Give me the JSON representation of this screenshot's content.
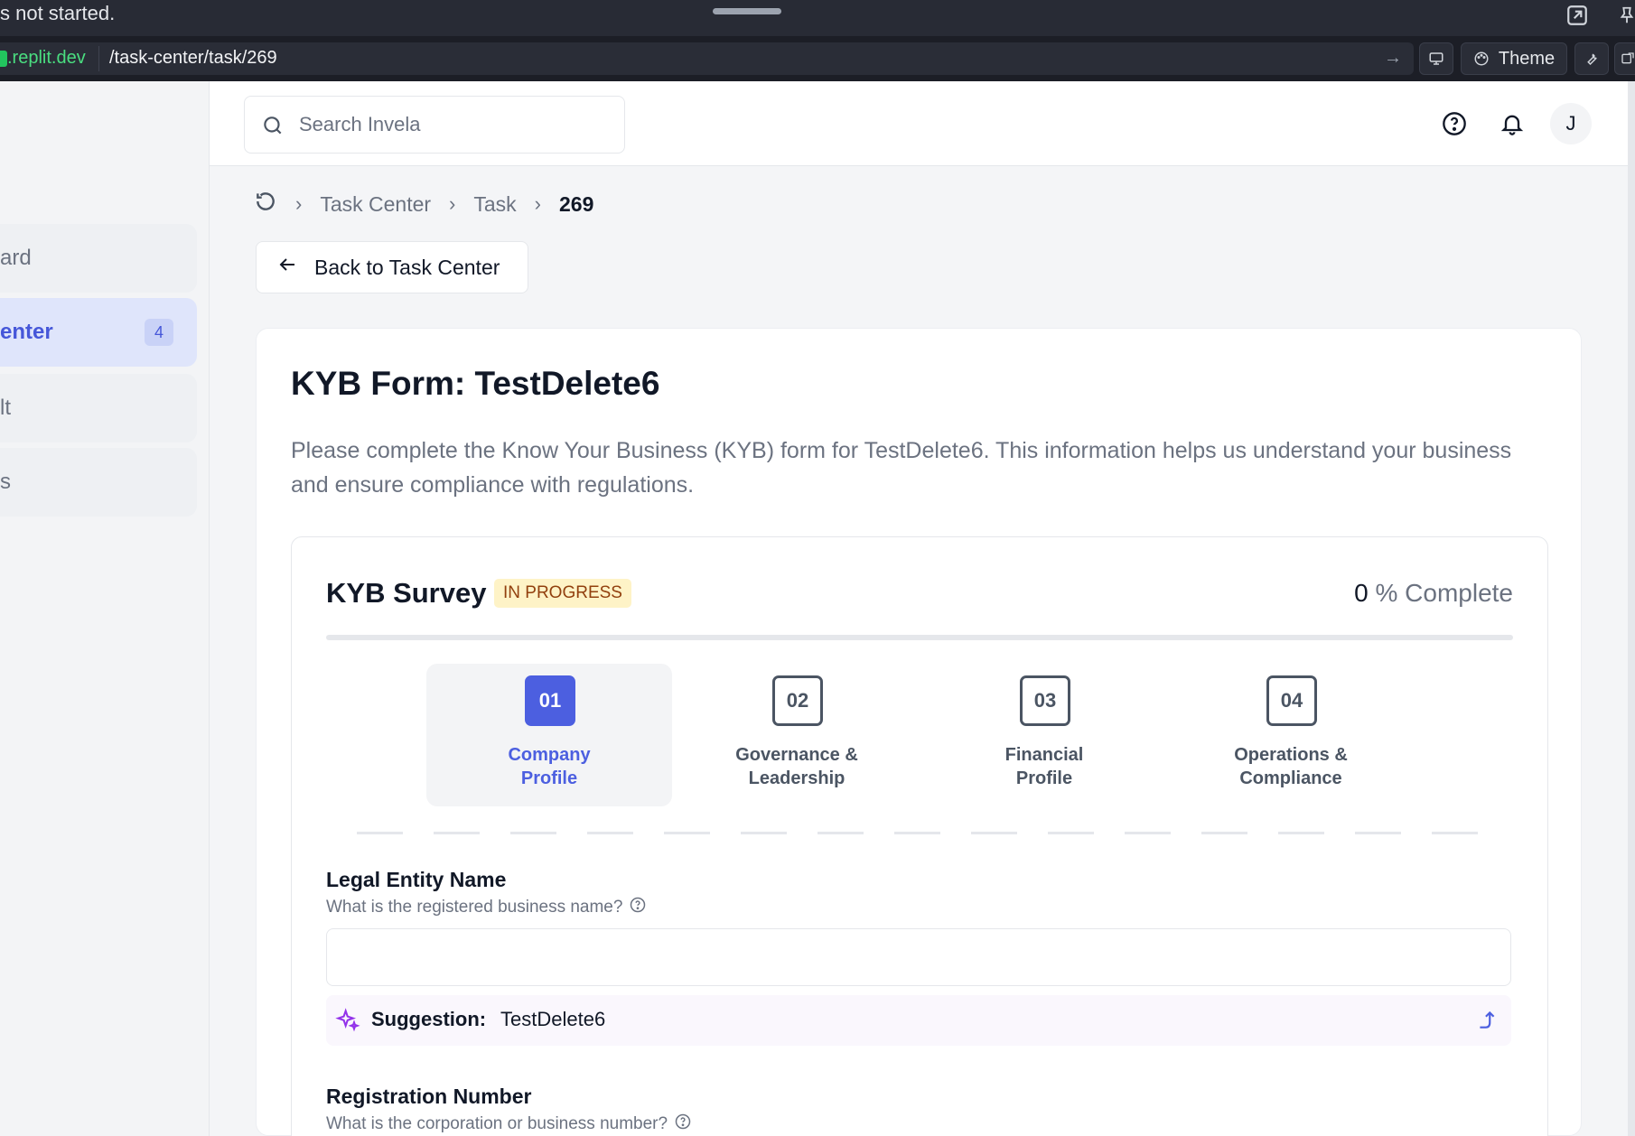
{
  "status_bar": {
    "text": "s not started."
  },
  "url_bar": {
    "domain": ".replit.dev",
    "path": "/task-center/task/269",
    "theme_label": "Theme"
  },
  "sidebar": {
    "items": [
      {
        "label": "ard",
        "active": false
      },
      {
        "label": "enter",
        "active": true,
        "badge": "4"
      },
      {
        "label": "lt",
        "active": false
      },
      {
        "label": "s",
        "active": false
      }
    ]
  },
  "header": {
    "search_placeholder": "Search Invela",
    "avatar_initial": "J"
  },
  "breadcrumb": {
    "items": [
      "Task Center",
      "Task"
    ],
    "current": "269"
  },
  "back_button": {
    "label": "Back to Task Center"
  },
  "form": {
    "title": "KYB Form: TestDelete6",
    "description": "Please complete the Know Your Business (KYB) form for TestDelete6. This information helps us understand your business and ensure compliance with regulations."
  },
  "survey": {
    "title": "KYB Survey",
    "status": "IN PROGRESS",
    "percent": "0",
    "percent_label": "% Complete",
    "progress_fraction": 0,
    "steps": [
      {
        "num": "01",
        "label_line1": "Company",
        "label_line2": "Profile",
        "active": true
      },
      {
        "num": "02",
        "label_line1": "Governance &",
        "label_line2": "Leadership",
        "active": false
      },
      {
        "num": "03",
        "label_line1": "Financial",
        "label_line2": "Profile",
        "active": false
      },
      {
        "num": "04",
        "label_line1": "Operations &",
        "label_line2": "Compliance",
        "active": false
      }
    ],
    "fields": [
      {
        "label": "Legal Entity Name",
        "help": "What is the registered business name?",
        "value": "",
        "suggestion_label": "Suggestion:",
        "suggestion_value": "TestDelete6"
      },
      {
        "label": "Registration Number",
        "help": "What is the corporation or business number?"
      }
    ]
  },
  "colors": {
    "accent": "#4c5fe0",
    "badge_bg": "#fef3c7",
    "badge_text": "#92400e",
    "sparkle": "#9333ea"
  }
}
